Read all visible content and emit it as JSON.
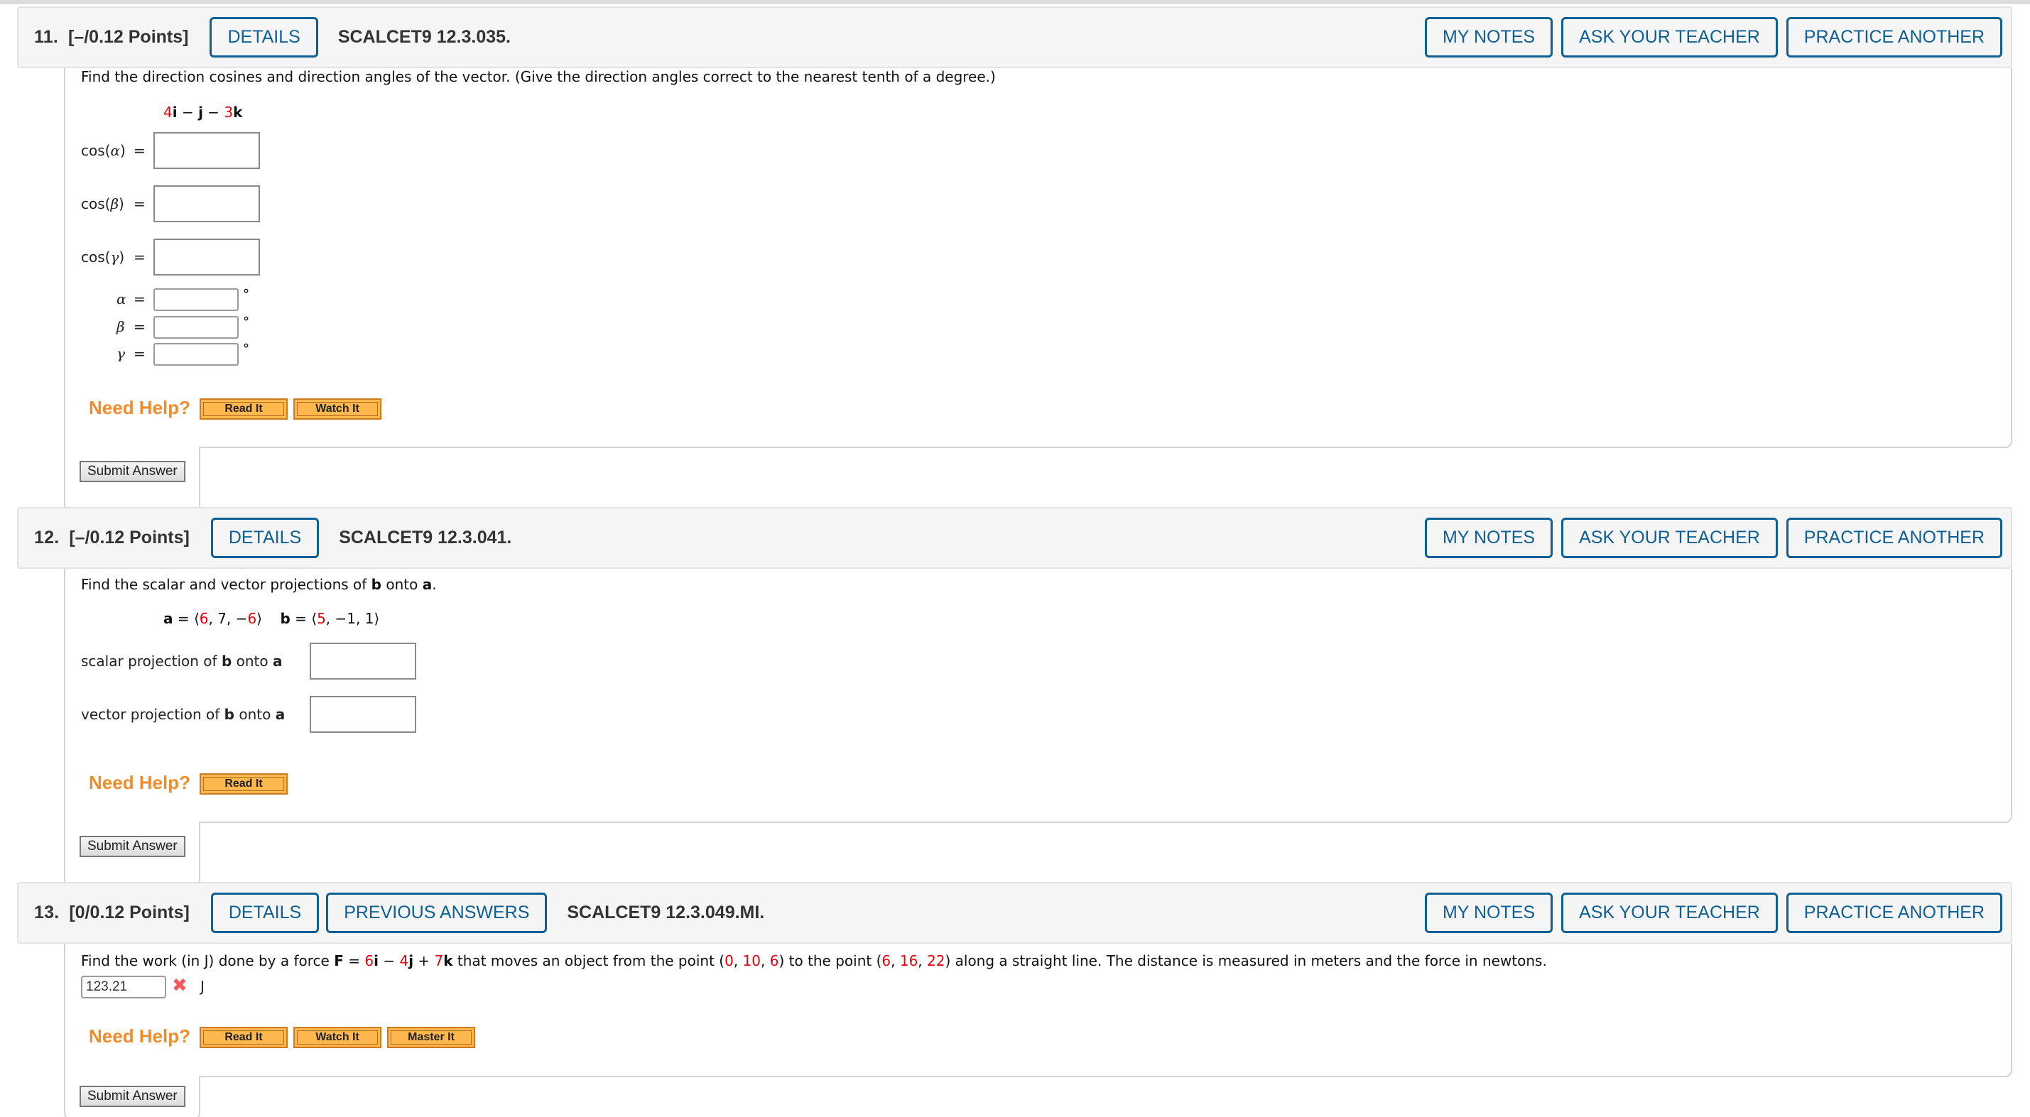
{
  "header_buttons": {
    "details": "DETAILS",
    "previous_answers": "PREVIOUS ANSWERS",
    "my_notes": "MY NOTES",
    "ask_teacher": "ASK YOUR TEACHER",
    "practice_another": "PRACTICE ANOTHER"
  },
  "help": {
    "need_help": "Need Help?",
    "read_it": "Read It",
    "watch_it": "Watch It",
    "master_it": "Master It"
  },
  "submit_label": "Submit Answer",
  "questions": [
    {
      "number": "11.",
      "points": "[–/0.12 Points]",
      "code": "SCALCET9 12.3.035.",
      "prompt": "Find the direction cosines and direction angles of the vector. (Give the direction angles correct to the nearest tenth of a degree.)",
      "vector": {
        "c1": "4",
        "t1": "i",
        "op1": " − ",
        "t2": "j",
        "op2": " − ",
        "c3": "3",
        "t3": "k"
      },
      "fields": [
        {
          "fn": "cos(",
          "sym": "α",
          "close": ")",
          "eq": "=",
          "value": ""
        },
        {
          "fn": "cos(",
          "sym": "β",
          "close": ")",
          "eq": "=",
          "value": ""
        },
        {
          "fn": "cos(",
          "sym": "γ",
          "close": ")",
          "eq": "=",
          "value": ""
        }
      ],
      "angles": [
        {
          "sym": "α",
          "eq": "=",
          "value": "",
          "unit": "°"
        },
        {
          "sym": "β",
          "eq": "=",
          "value": "",
          "unit": "°"
        },
        {
          "sym": "γ",
          "eq": "=",
          "value": "",
          "unit": "°"
        }
      ]
    },
    {
      "number": "12.",
      "points": "[–/0.12 Points]",
      "code": "SCALCET9 12.3.041.",
      "prompt": {
        "p1": "Find the scalar and vector projections of ",
        "b": "b",
        "p2": " onto ",
        "a": "a",
        "p3": "."
      },
      "vectors": {
        "a_name": "a",
        "eq": " = ",
        "lang": "⟨",
        "rang": "⟩",
        "a1": "6",
        "a2": ", 7, −",
        "a3": "6",
        "b_name": "b",
        "b1": "5",
        "b_rest": ", −1, 1"
      },
      "fields": [
        {
          "pre": "scalar projection of ",
          "b": "b",
          "mid": " onto ",
          "a": "a",
          "value": ""
        },
        {
          "pre": "vector projection of ",
          "b": "b",
          "mid": " onto ",
          "a": "a",
          "value": ""
        }
      ]
    },
    {
      "number": "13.",
      "points": "[0/0.12 Points]",
      "code": "SCALCET9 12.3.049.MI.",
      "prompt": {
        "p1": "Find the work (in J) done by a force ",
        "F": "F",
        "eq": " = ",
        "c1": "6",
        "i": "i",
        "op1": " − ",
        "c2": "4",
        "j": "j",
        "op2": " + ",
        "c3": "7",
        "k": "k",
        "p2": " that moves an object from the point (",
        "s1": "0",
        "s2": "10",
        "s3": "6",
        "p3": ") to the point (",
        "e1": "6",
        "e2": "16",
        "e3": "22",
        "p4": ") along a straight line. The distance is measured in meters and the force in newtons.",
        "comma": ", "
      },
      "answer": {
        "value": "123.21",
        "status": "incorrect",
        "status_icon": "✖",
        "unit": "J"
      }
    }
  ],
  "colors": {
    "accent": "#0e5f93",
    "highlight_red": "#e8000b",
    "help_orange": "#f08c2a",
    "help_button": "#ffb84d",
    "incorrect": "#f05a5a"
  }
}
